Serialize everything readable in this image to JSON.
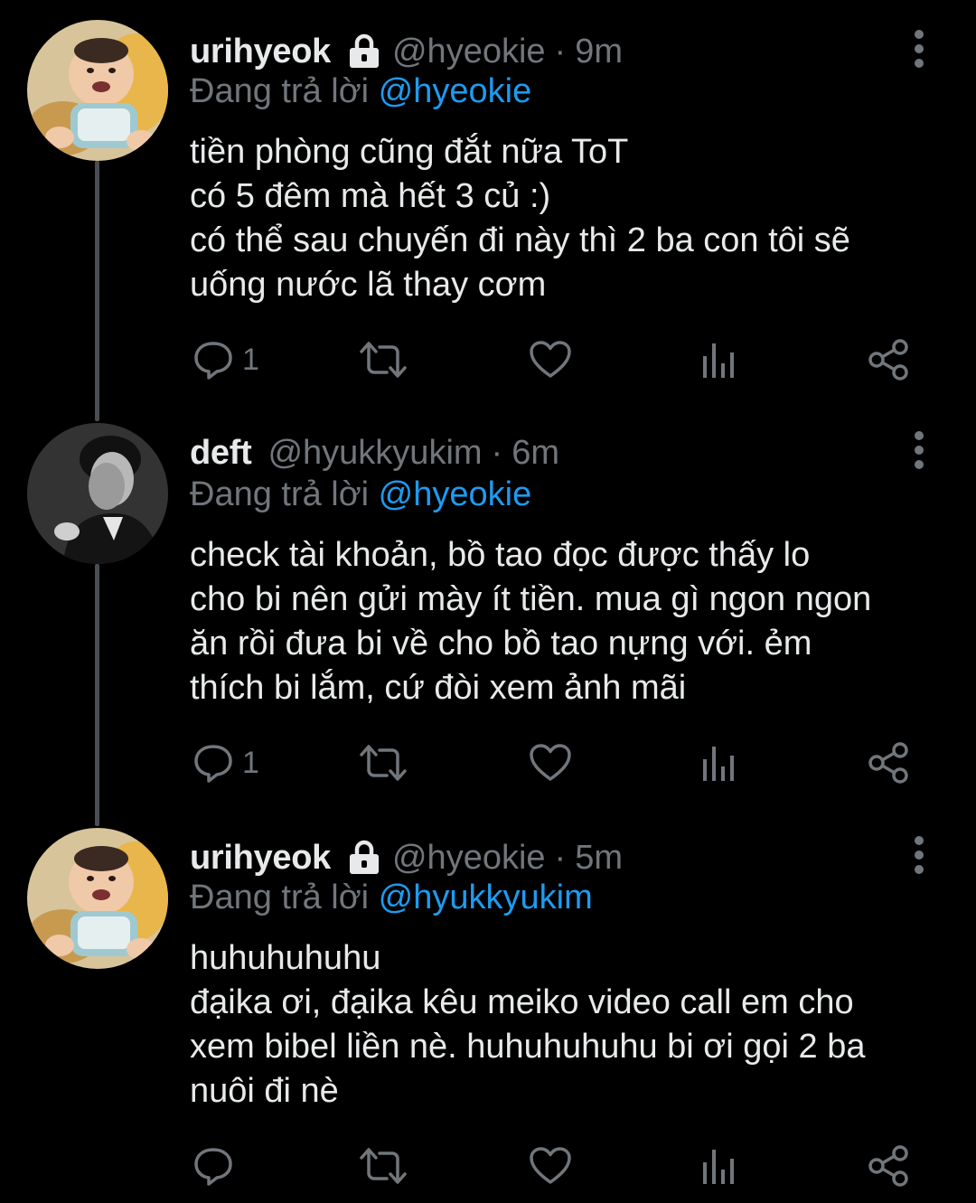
{
  "colors": {
    "background": "#000000",
    "text": "#e7e9ea",
    "muted": "#71767b",
    "link": "#1d9bf0",
    "thread_line": "#4a4e52"
  },
  "tweets": [
    {
      "display_name": "urihyeok",
      "protected": true,
      "handle": "@hyeokie",
      "separator": "·",
      "time": "9m",
      "reply_prefix": "Đang trả lời",
      "reply_target": "@hyeokie",
      "lines": [
        "tiền phòng cũng đắt nữa ToT",
        "có 5 đêm mà hết 3 củ :)",
        "có thể sau chuyến đi này thì 2 ba con tôi sẽ",
        "uống nước lã thay cơm"
      ],
      "reply_count": "1",
      "avatar_icon": "baby-avatar"
    },
    {
      "display_name": "deft",
      "protected": false,
      "handle": "@hyukkyukim",
      "separator": "·",
      "time": "6m",
      "reply_prefix": "Đang trả lời",
      "reply_target": "@hyeokie",
      "lines": [
        "check tài khoản, bồ tao đọc được thấy lo",
        "cho bi nên gửi mày ít tiền. mua gì ngon ngon",
        "ăn rồi đưa bi về cho bồ tao nựng với. ẻm",
        "thích bi lắm, cứ đòi xem ảnh mãi"
      ],
      "reply_count": "1",
      "avatar_icon": "man-bw-avatar"
    },
    {
      "display_name": "urihyeok",
      "protected": true,
      "handle": "@hyeokie",
      "separator": "·",
      "time": "5m",
      "reply_prefix": "Đang trả lời",
      "reply_target": "@hyukkyukim",
      "lines": [
        "huhuhuhuhu",
        "đạika ơi, đạika kêu meiko video call em cho",
        "xem bibel liền nè. huhuhuhuhu bi ơi gọi 2 ba",
        "nuôi đi nè"
      ],
      "reply_count": "",
      "avatar_icon": "baby-avatar"
    }
  ]
}
